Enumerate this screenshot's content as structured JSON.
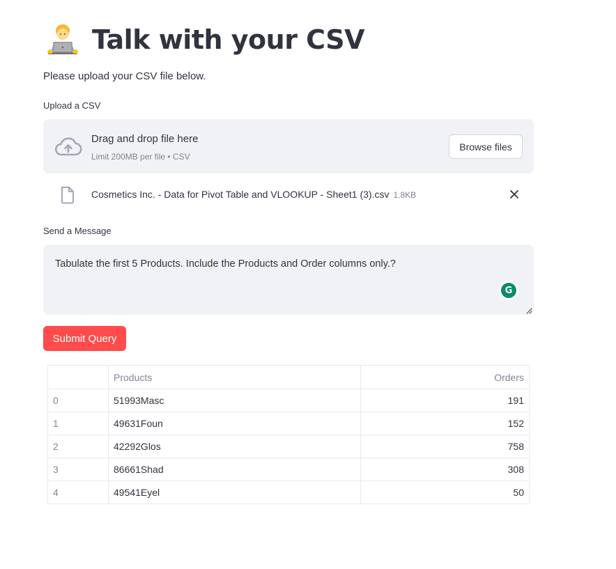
{
  "header": {
    "title": "Talk with your CSV",
    "icon": "technologist-emoji-icon"
  },
  "intro_text": "Please upload your CSV file below.",
  "uploader": {
    "label": "Upload a CSV",
    "drop_text": "Drag and drop file here",
    "limit_text": "Limit 200MB per file • CSV",
    "browse_label": "Browse files",
    "file": {
      "name": "Cosmetics Inc. - Data for Pivot Table and VLOOKUP - Sheet1 (3).csv",
      "size": "1.8KB"
    }
  },
  "message": {
    "label": "Send a Message",
    "value": "Tabulate the first 5 Products. Include the Products and Order columns only.?",
    "grammarly_letter": "G"
  },
  "submit_label": "Submit Query",
  "table": {
    "columns": [
      "",
      "Products",
      "Orders"
    ],
    "rows": [
      {
        "index": "0",
        "product": "51993Masc",
        "orders": "191"
      },
      {
        "index": "1",
        "product": "49631Foun",
        "orders": "152"
      },
      {
        "index": "2",
        "product": "42292Glos",
        "orders": "758"
      },
      {
        "index": "3",
        "product": "86661Shad",
        "orders": "308"
      },
      {
        "index": "4",
        "product": "49541Eyel",
        "orders": "50"
      }
    ]
  },
  "colors": {
    "primary": "#ff4b4b",
    "text": "#31333f",
    "muted": "#808495",
    "input_bg": "#f0f2f6"
  }
}
